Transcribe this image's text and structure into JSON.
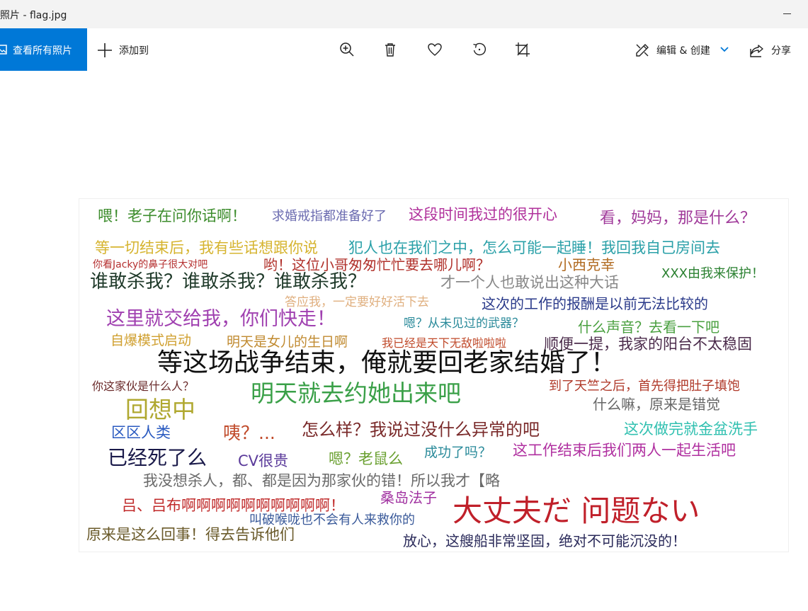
{
  "window": {
    "title": "照片 - flag.jpg"
  },
  "toolbar": {
    "view_all_label": "查看所有照片",
    "add_to_label": "添加到",
    "edit_create_label": "编辑 & 创建",
    "share_label": "分享"
  },
  "colors": {
    "accent": "#0078d7"
  },
  "icons": [
    "photos-icon",
    "plus-icon",
    "zoom-in-icon",
    "trash-icon",
    "heart-icon",
    "rotate-icon",
    "crop-icon",
    "edit-pen-icon",
    "chevron-down-icon",
    "share-icon"
  ],
  "image": {
    "phrases": [
      {
        "text": "喂！老子在问你话啊！",
        "color": "#3c8c2c"
      },
      {
        "text": "求婚戒指都准备好了",
        "color": "#6b6bb0"
      },
      {
        "text": "这段时间我过的很开心",
        "color": "#b0309b"
      },
      {
        "text": "看，妈妈，那是什么？",
        "color": "#a03a9a"
      },
      {
        "text": "等一切结束后，我有些话想跟你说",
        "color": "#d6b430"
      },
      {
        "text": "犯人也在我们之中，怎么可能一起睡！我回我自己房间去",
        "color": "#2aa0a8"
      },
      {
        "text": "你看Jacky的鼻子很大对吧",
        "color": "#b53030"
      },
      {
        "text": "哟！这位小哥匆匆忙忙要去哪儿啊？",
        "color": "#b0302a"
      },
      {
        "text": "小西克幸",
        "color": "#b06a20"
      },
      {
        "text": "XXX由我来保护！",
        "color": "#2a8030"
      },
      {
        "text": "谁敢杀我？谁敢杀我？谁敢杀我？",
        "color": "#1f3a2a"
      },
      {
        "text": "才一个人也敢说出这种大话",
        "color": "#888888"
      },
      {
        "text": "答应我，一定要好好活下去",
        "color": "#e0b080"
      },
      {
        "text": "这次的工作的报酬是以前无法比较的",
        "color": "#2a3a8a"
      },
      {
        "text": "这里就交给我，你们快走！",
        "color": "#a040b0"
      },
      {
        "text": "嗯？从未见过的武器？",
        "color": "#2a8a9a"
      },
      {
        "text": "什么声音？去看一下吧",
        "color": "#4aa040"
      },
      {
        "text": "自爆模式启动",
        "color": "#d0a030"
      },
      {
        "text": "明天是女儿的生日啊",
        "color": "#c08a30"
      },
      {
        "text": "我已经是天下无敌啦啦啦",
        "color": "#c04a2a"
      },
      {
        "text": "顺便一提，我家的阳台不太稳固",
        "color": "#4a2a4a"
      },
      {
        "text": "等这场战争结束，俺就要回老家结婚了！",
        "color": "#111111"
      },
      {
        "text": "你这家伙是什么人？",
        "color": "#6a2a2a"
      },
      {
        "text": "明天就去约她出来吧",
        "color": "#3aa048"
      },
      {
        "text": "到了天竺之后，首先得把肚子填饱",
        "color": "#b03a2a"
      },
      {
        "text": "回想中",
        "color": "#b0a830"
      },
      {
        "text": "什么嘛，原来是错觉",
        "color": "#666666"
      },
      {
        "text": "区区人类",
        "color": "#2a5ac0"
      },
      {
        "text": "咦？...",
        "color": "#c04a2a"
      },
      {
        "text": "怎么样？我说过没什么异常的吧",
        "color": "#7a2a2a"
      },
      {
        "text": "这次做完就金盆洗手",
        "color": "#30c0b0"
      },
      {
        "text": "已经死了么",
        "color": "#1a1a4a"
      },
      {
        "text": "CV很贵",
        "color": "#5a3a9a"
      },
      {
        "text": "嗯？老鼠么",
        "color": "#6aa030"
      },
      {
        "text": "成功了吗？",
        "color": "#2a8a9a"
      },
      {
        "text": "这工作结束后我们两人一起生活吧",
        "color": "#b030a0"
      },
      {
        "text": "我没想杀人，都、都是因为那家伙的错！所以我才【略",
        "color": "#6a6a6a"
      },
      {
        "text": "桑岛法子",
        "color": "#a030a0"
      },
      {
        "text": "吕、吕布啊啊啊啊啊啊啊啊啊啊！",
        "color": "#c02a2a"
      },
      {
        "text": "大丈夫だ 问题ない",
        "color": "#c0202a"
      },
      {
        "text": "叫破喉咙也不会有人来救你的",
        "color": "#3a5a9a"
      },
      {
        "text": "原来是这么回事！得去告诉他们",
        "color": "#6a5a2a"
      },
      {
        "text": "放心，这艘船非常坚固，绝对不可能沉没的！",
        "color": "#2a2a5a"
      }
    ]
  }
}
